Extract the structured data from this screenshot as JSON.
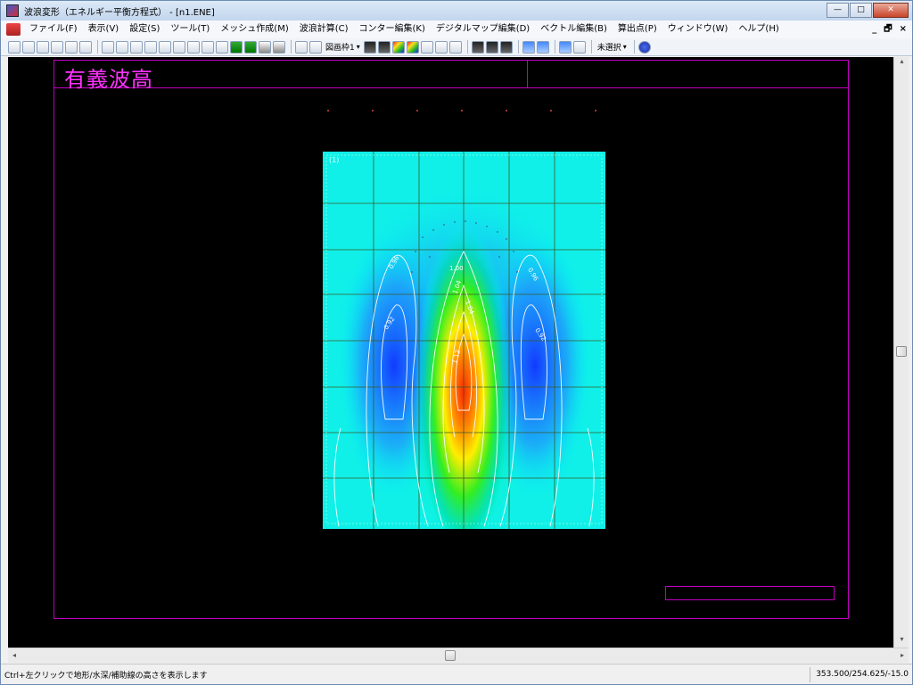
{
  "window": {
    "title": "波浪変形（エネルギー平衡方程式） - [n1.ENE]",
    "controls": {
      "minimize": "—",
      "maximize": "□",
      "close": "✕"
    }
  },
  "menubar": {
    "items": [
      "ファイル(F)",
      "表示(V)",
      "設定(S)",
      "ツール(T)",
      "メッシュ作成(M)",
      "波浪計算(C)",
      "コンター編集(K)",
      "デジタルマップ編集(D)",
      "ベクトル編集(B)",
      "算出点(P)",
      "ウィンドウ(W)",
      "ヘルプ(H)"
    ],
    "mdi_controls": {
      "minimize": "_",
      "restore": "🗗",
      "close": "×"
    }
  },
  "toolbar": {
    "zoom_label": "図画枠1",
    "selection_label": "未選択"
  },
  "drawing": {
    "title": "有義波高",
    "plot_label": "(1)",
    "contour_labels": [
      "0.96",
      "0.96",
      "1.00",
      "0.92",
      "0.92",
      "1.04",
      "1.04",
      "1.12"
    ]
  },
  "status": {
    "message": "Ctrl+左クリックで地形/水深/補助線の高さを表示します",
    "coordinates": "353.500/254.625/-15.0"
  },
  "colors": {
    "canvas_bg": "#000000",
    "frame_line": "#c000c0",
    "title_text": "#ff32ff",
    "heatmap_low": "#1a3cff",
    "heatmap_mid": "#00ffee",
    "heatmap_high": "#ff2000"
  }
}
